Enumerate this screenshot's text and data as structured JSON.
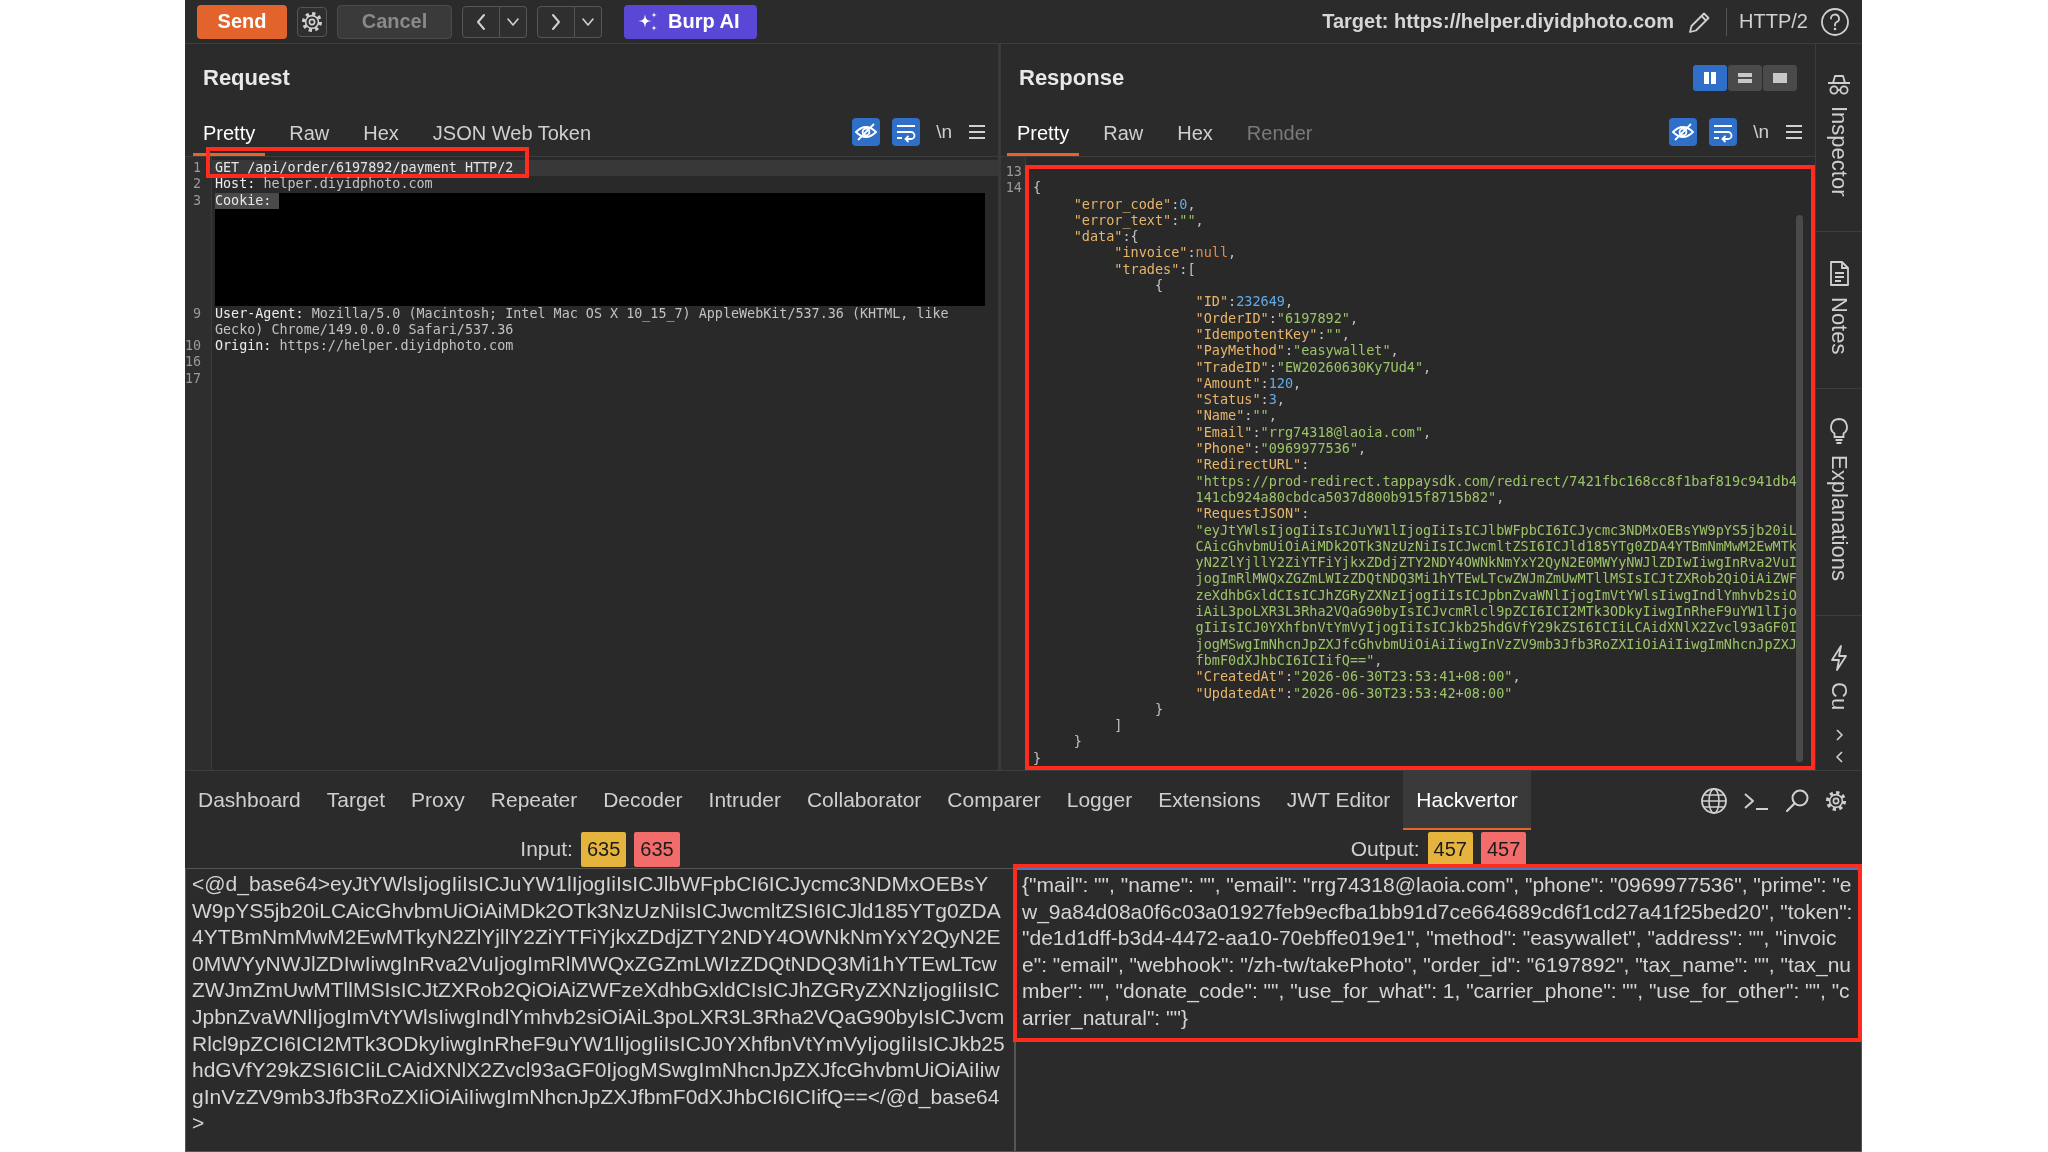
{
  "toolbar": {
    "send": "Send",
    "cancel": {
      "label": "Cancel",
      "disabled": true
    },
    "ai_button": "Burp AI",
    "target": "Target: https://helper.diyidphoto.com",
    "protocol": "HTTP/2"
  },
  "request": {
    "title": "Request",
    "tabs": [
      {
        "label": "Pretty",
        "selected": true
      },
      {
        "label": "Raw",
        "selected": false
      },
      {
        "label": "Hex",
        "selected": false
      },
      {
        "label": "JSON Web Token",
        "selected": false
      }
    ],
    "toggles": [
      {
        "kind": "hide",
        "on": true
      },
      {
        "kind": "wrap",
        "on": true
      },
      {
        "kind": "newline",
        "label": "\\n",
        "on": false
      }
    ],
    "lines": [
      {
        "number": "1",
        "kind": "request_line",
        "text": "GET /api/order/6197892/payment HTTP/2",
        "cursor": true,
        "highlighted": true
      },
      {
        "number": "2",
        "kind": "header",
        "name": "Host:",
        "value": "helper.diyidphoto.com",
        "cursor": false,
        "highlighted": false
      },
      {
        "number": "3",
        "kind": "redacted_header",
        "name": "Cookie:",
        "cursor": false,
        "highlighted": false
      },
      {
        "number": "9",
        "kind": "header",
        "name": "User-Agent:",
        "value": "Mozilla/5.0 (Macintosh; Intel Mac OS X 10_15_7) AppleWebKit/537.36 (KHTML, like Gecko) Chrome/149.0.0.0 Safari/537.36",
        "cursor": false,
        "highlighted": false
      },
      {
        "number": "10",
        "kind": "header",
        "name": "Origin:",
        "value": "https://helper.diyidphoto.com",
        "cursor": false,
        "highlighted": false
      },
      {
        "number": "16",
        "kind": "blank",
        "cursor": false,
        "highlighted": false
      },
      {
        "number": "17",
        "kind": "blank",
        "cursor": false,
        "highlighted": false
      }
    ]
  },
  "response": {
    "title": "Response",
    "layout_buttons": [
      {
        "kind": "columns",
        "selected": true
      },
      {
        "kind": "rows",
        "selected": false
      },
      {
        "kind": "single",
        "selected": false
      }
    ],
    "tabs": [
      {
        "label": "Pretty",
        "selected": true,
        "disabled": false
      },
      {
        "label": "Raw",
        "selected": false,
        "disabled": false
      },
      {
        "label": "Hex",
        "selected": false,
        "disabled": false
      },
      {
        "label": "Render",
        "selected": false,
        "disabled": true
      }
    ],
    "toggles": [
      {
        "kind": "hide",
        "on": true
      },
      {
        "kind": "wrap",
        "on": true
      },
      {
        "kind": "newline",
        "label": "\\n",
        "on": false
      }
    ],
    "highlighted": true,
    "lines": [
      {
        "number": "13"
      },
      {
        "number": "14",
        "tree": [
          {
            "tokens": [
              {
                "kind": "punct",
                "text": "{"
              }
            ],
            "children": [
              {
                "tokens": [
                  {
                    "kind": "key",
                    "text": "\"error_code\""
                  },
                  {
                    "kind": "punct",
                    "text": ":"
                  },
                  {
                    "kind": "number",
                    "text": "0"
                  },
                  {
                    "kind": "punct",
                    "text": ","
                  }
                ]
              },
              {
                "tokens": [
                  {
                    "kind": "key",
                    "text": "\"error_text\""
                  },
                  {
                    "kind": "punct",
                    "text": ":"
                  },
                  {
                    "kind": "string",
                    "text": "\"\""
                  },
                  {
                    "kind": "punct",
                    "text": ","
                  }
                ]
              },
              {
                "tokens": [
                  {
                    "kind": "key",
                    "text": "\"data\""
                  },
                  {
                    "kind": "punct",
                    "text": ":{"
                  }
                ],
                "children": [
                  {
                    "tokens": [
                      {
                        "kind": "key",
                        "text": "\"invoice\""
                      },
                      {
                        "kind": "punct",
                        "text": ":"
                      },
                      {
                        "kind": "literal",
                        "text": "null"
                      },
                      {
                        "kind": "punct",
                        "text": ","
                      }
                    ]
                  },
                  {
                    "tokens": [
                      {
                        "kind": "key",
                        "text": "\"trades\""
                      },
                      {
                        "kind": "punct",
                        "text": ":["
                      }
                    ],
                    "children": [
                      {
                        "tokens": [
                          {
                            "kind": "punct",
                            "text": "{"
                          }
                        ],
                        "children": [
                          {
                            "tokens": [
                              {
                                "kind": "key",
                                "text": "\"ID\""
                              },
                              {
                                "kind": "punct",
                                "text": ":"
                              },
                              {
                                "kind": "number",
                                "text": "232649"
                              },
                              {
                                "kind": "punct",
                                "text": ","
                              }
                            ]
                          },
                          {
                            "tokens": [
                              {
                                "kind": "key",
                                "text": "\"OrderID\""
                              },
                              {
                                "kind": "punct",
                                "text": ":"
                              },
                              {
                                "kind": "string",
                                "text": "\"6197892\""
                              },
                              {
                                "kind": "punct",
                                "text": ","
                              }
                            ]
                          },
                          {
                            "tokens": [
                              {
                                "kind": "key",
                                "text": "\"IdempotentKey\""
                              },
                              {
                                "kind": "punct",
                                "text": ":"
                              },
                              {
                                "kind": "string",
                                "text": "\"\""
                              },
                              {
                                "kind": "punct",
                                "text": ","
                              }
                            ]
                          },
                          {
                            "tokens": [
                              {
                                "kind": "key",
                                "text": "\"PayMethod\""
                              },
                              {
                                "kind": "punct",
                                "text": ":"
                              },
                              {
                                "kind": "string",
                                "text": "\"easywallet\""
                              },
                              {
                                "kind": "punct",
                                "text": ","
                              }
                            ]
                          },
                          {
                            "tokens": [
                              {
                                "kind": "key",
                                "text": "\"TradeID\""
                              },
                              {
                                "kind": "punct",
                                "text": ":"
                              },
                              {
                                "kind": "string",
                                "text": "\"EW20260630Ky7Ud4\""
                              },
                              {
                                "kind": "punct",
                                "text": ","
                              }
                            ]
                          },
                          {
                            "tokens": [
                              {
                                "kind": "key",
                                "text": "\"Amount\""
                              },
                              {
                                "kind": "punct",
                                "text": ":"
                              },
                              {
                                "kind": "number",
                                "text": "120"
                              },
                              {
                                "kind": "punct",
                                "text": ","
                              }
                            ]
                          },
                          {
                            "tokens": [
                              {
                                "kind": "key",
                                "text": "\"Status\""
                              },
                              {
                                "kind": "punct",
                                "text": ":"
                              },
                              {
                                "kind": "number",
                                "text": "3"
                              },
                              {
                                "kind": "punct",
                                "text": ","
                              }
                            ]
                          },
                          {
                            "tokens": [
                              {
                                "kind": "key",
                                "text": "\"Name\""
                              },
                              {
                                "kind": "punct",
                                "text": ":"
                              },
                              {
                                "kind": "string",
                                "text": "\"\""
                              },
                              {
                                "kind": "punct",
                                "text": ","
                              }
                            ]
                          },
                          {
                            "tokens": [
                              {
                                "kind": "key",
                                "text": "\"Email\""
                              },
                              {
                                "kind": "punct",
                                "text": ":"
                              },
                              {
                                "kind": "string",
                                "text": "\"rrg74318@laoia.com\""
                              },
                              {
                                "kind": "punct",
                                "text": ","
                              }
                            ]
                          },
                          {
                            "tokens": [
                              {
                                "kind": "key",
                                "text": "\"Phone\""
                              },
                              {
                                "kind": "punct",
                                "text": ":"
                              },
                              {
                                "kind": "string",
                                "text": "\"0969977536\""
                              },
                              {
                                "kind": "punct",
                                "text": ","
                              }
                            ]
                          },
                          {
                            "tokens": [
                              {
                                "kind": "key",
                                "text": "\"RedirectURL\""
                              },
                              {
                                "kind": "punct",
                                "text": ":"
                              }
                            ]
                          },
                          {
                            "tokens": [
                              {
                                "kind": "string",
                                "text": "\"https://prod-redirect.tappaysdk.com/redirect/7421fbc168cc8f1baf819c941db4141cb924a80cbdca5037d800b915f8715b82\""
                              },
                              {
                                "kind": "punct",
                                "text": ","
                              }
                            ]
                          },
                          {
                            "tokens": [
                              {
                                "kind": "key",
                                "text": "\"RequestJSON\""
                              },
                              {
                                "kind": "punct",
                                "text": ":"
                              }
                            ]
                          },
                          {
                            "tokens": [
                              {
                                "kind": "string",
                                "text": "\"eyJtYWlsIjogIiIsICJuYW1lIjogIiIsICJlbWFpbCI6ICJycmc3NDMxOEBsYW9pYS5jb20iLCAicGhvbmUiOiAiMDk2OTk3NzUzNiIsICJwcmltZSI6ICJld185YTg0ZDA4YTBmNmMwM2EwMTkyN2ZlYjllY2ZiYTFiYjkxZDdjZTY2NDY4OWNkNmYxY2QyN2E0MWYyNWJlZDIwIiwgInRva2VuIjogImRlMWQxZGZmLWIzZDQtNDQ3Mi1hYTEwLTcwZWJmZmUwMTllMSIsICJtZXRob2QiOiAiZWFzeXdhbGxldCIsICJhZGRyZXNzIjogIiIsICJpbnZvaWNlIjogImVtYWlsIiwgIndlYmhvb2siOiAiL3poLXR3L3Rha2VQaG90byIsICJvcmRlcl9pZCI6ICI2MTk3ODkyIiwgInRheF9uYW1lIjogIiIsICJ0YXhfbnVtYmVyIjogIiIsICJkb25hdGVfY29kZSI6ICIiLCAidXNlX2Zvcl93aGF0IjogMSwgImNhcnJpZXJfcGhvbmUiOiAiIiwgInVzZV9mb3Jfb3RoZXIiOiAiIiwgImNhcnJpZXJfbmF0dXJhbCI6ICIifQ==\""
                              },
                              {
                                "kind": "punct",
                                "text": ","
                              }
                            ]
                          },
                          {
                            "tokens": [
                              {
                                "kind": "key",
                                "text": "\"CreatedAt\""
                              },
                              {
                                "kind": "punct",
                                "text": ":"
                              },
                              {
                                "kind": "string",
                                "text": "\"2026-06-30T23:53:41+08:00\""
                              },
                              {
                                "kind": "punct",
                                "text": ","
                              }
                            ]
                          },
                          {
                            "tokens": [
                              {
                                "kind": "key",
                                "text": "\"UpdatedAt\""
                              },
                              {
                                "kind": "punct",
                                "text": ":"
                              },
                              {
                                "kind": "string",
                                "text": "\"2026-06-30T23:53:42+08:00\""
                              }
                            ]
                          }
                        ]
                      },
                      {
                        "tokens": [
                          {
                            "kind": "punct",
                            "text": "}"
                          }
                        ]
                      }
                    ]
                  },
                  {
                    "tokens": [
                      {
                        "kind": "punct",
                        "text": "]"
                      }
                    ]
                  }
                ]
              },
              {
                "tokens": [
                  {
                    "kind": "punct",
                    "text": "}"
                  }
                ]
              }
            ]
          },
          {
            "tokens": [
              {
                "kind": "punct",
                "text": "}"
              }
            ]
          }
        ]
      }
    ]
  },
  "sidebar": [
    {
      "kind": "inspector",
      "label": "Inspector"
    },
    {
      "kind": "notes",
      "label": "Notes"
    },
    {
      "kind": "explanations",
      "label": "Explanations"
    },
    {
      "kind": "custom",
      "label": "Cu"
    }
  ],
  "main_tabs": [
    {
      "label": "Dashboard",
      "selected": false
    },
    {
      "label": "Target",
      "selected": false
    },
    {
      "label": "Proxy",
      "selected": false
    },
    {
      "label": "Repeater",
      "selected": false
    },
    {
      "label": "Decoder",
      "selected": false
    },
    {
      "label": "Intruder",
      "selected": false
    },
    {
      "label": "Collaborator",
      "selected": false
    },
    {
      "label": "Comparer",
      "selected": false
    },
    {
      "label": "Logger",
      "selected": false
    },
    {
      "label": "Extensions",
      "selected": false
    },
    {
      "label": "JWT Editor",
      "selected": false
    },
    {
      "label": "Hackvertor",
      "selected": true
    }
  ],
  "hackvertor": {
    "input": {
      "label": "Input:",
      "counts": [
        {
          "text": "635",
          "color": "#e5b43c"
        },
        {
          "text": "635",
          "color": "#f36c6c"
        }
      ],
      "text": "<@d_base64>eyJtYWlsIjogIiIsICJuYW1lIjogIiIsICJlbWFpbCI6ICJycmc3NDMxOEBsYW9pYS5jb20iLCAicGhvbmUiOiAiMDk2OTk3NzUzNiIsICJwcmltZSI6ICJld185YTg0ZDA4YTBmNmMwM2EwMTkyN2ZlYjllY2ZiYTFiYjkxZDdjZTY2NDY4OWNkNmYxY2QyN2E0MWYyNWJlZDIwIiwgInRva2VuIjogImRlMWQxZGZmLWIzZDQtNDQ3Mi1hYTEwLTcwZWJmZmUwMTllMSIsICJtZXRob2QiOiAiZWFzeXdhbGxldCIsICJhZGRyZXNzIjogIiIsICJpbnZvaWNlIjogImVtYWlsIiwgIndlYmhvb2siOiAiL3poLXR3L3Rha2VQaG90byIsICJvcmRlcl9pZCI6ICI2MTk3ODkyIiwgInRheF9uYW1lIjogIiIsICJ0YXhfbnVtYmVyIjogIiIsICJkb25hdGVfY29kZSI6ICIiLCAidXNlX2Zvcl93aGF0IjogMSwgImNhcnJpZXJfcGhvbmUiOiAiIiwgInVzZV9mb3Jfb3RoZXIiOiAiIiwgImNhcnJpZXJfbmF0dXJhbCI6ICIifQ==</@d_base64>",
      "focused": false,
      "highlighted": false
    },
    "output": {
      "label": "Output:",
      "counts": [
        {
          "text": "457",
          "color": "#e5b43c"
        },
        {
          "text": "457",
          "color": "#f36c6c"
        }
      ],
      "text": "{\"mail\": \"\", \"name\": \"\", \"email\": \"rrg74318@laoia.com\", \"phone\": \"0969977536\", \"prime\": \"ew_9a84d08a0f6c03a01927feb9ecfba1bb91d7ce664689cd6f1cd27a41f25bed20\", \"token\": \"de1d1dff-b3d4-4472-aa10-70ebffe019e1\", \"method\": \"easywallet\", \"address\": \"\", \"invoice\": \"email\", \"webhook\": \"/zh-tw/takePhoto\", \"order_id\": \"6197892\", \"tax_name\": \"\", \"tax_number\": \"\", \"donate_code\": \"\", \"use_for_what\": 1, \"carrier_phone\": \"\", \"use_for_other\": \"\", \"carrier_natural\": \"\"}",
      "focused": true,
      "highlighted": true
    }
  }
}
